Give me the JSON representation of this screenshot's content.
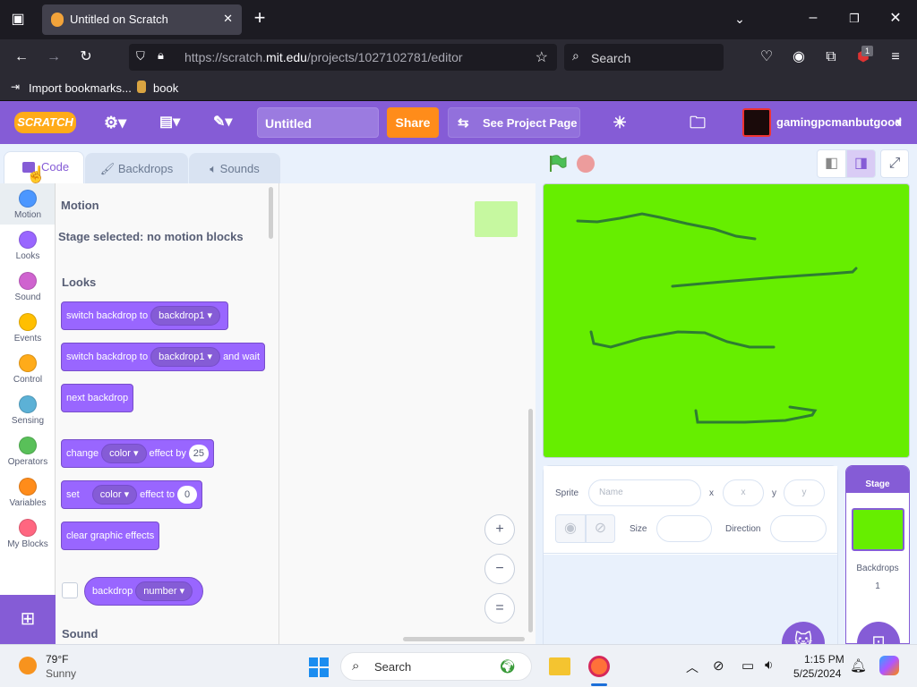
{
  "browser": {
    "tab_title": "Untitled on Scratch",
    "tab_close": "✕",
    "new_tab": "+",
    "url_prefix": "https://scratch.",
    "url_host": "mit.edu",
    "url_path": "/projects/1027102781/editor",
    "search_placeholder": "Search",
    "bookmarks": [
      {
        "label": "Import bookmarks..."
      },
      {
        "label": "book"
      }
    ],
    "extension_badge": "1"
  },
  "scratch_menu": {
    "logo": "SCRATCH",
    "project_title": "Untitled",
    "share_label": "Share",
    "see_project_label": "See Project Page",
    "username": "gamingpcmanbutgood"
  },
  "editor_tabs": [
    {
      "label": "Code"
    },
    {
      "label": "Backdrops"
    },
    {
      "label": "Sounds"
    }
  ],
  "categories": [
    {
      "label": "Motion",
      "color": "#4c97ff"
    },
    {
      "label": "Looks",
      "color": "#9966ff"
    },
    {
      "label": "Sound",
      "color": "#cf63cf"
    },
    {
      "label": "Events",
      "color": "#ffbf00"
    },
    {
      "label": "Control",
      "color": "#ffab19"
    },
    {
      "label": "Sensing",
      "color": "#5cb1d6"
    },
    {
      "label": "Operators",
      "color": "#59c059"
    },
    {
      "label": "Variables",
      "color": "#ff8c1a"
    },
    {
      "label": "My Blocks",
      "color": "#ff6680"
    }
  ],
  "palette": {
    "motion_title": "Motion",
    "motion_note": "Stage selected: no motion blocks",
    "looks_title": "Looks",
    "block1": {
      "text": "switch backdrop to",
      "dropdown": "backdrop1"
    },
    "block2": {
      "text": "switch backdrop to",
      "dropdown": "backdrop1",
      "suffix": "and wait"
    },
    "block3": {
      "text": "next backdrop"
    },
    "block4": {
      "text": "change",
      "dropdown": "color",
      "middle": "effect by",
      "value": "25"
    },
    "block5": {
      "text": "set",
      "dropdown": "color",
      "middle": "effect to",
      "value": "0"
    },
    "block6": {
      "text": "clear graphic effects"
    },
    "block7": {
      "text": "backdrop",
      "dropdown": "number"
    },
    "sound_title": "Sound"
  },
  "zoom": {
    "in": "+",
    "out": "−",
    "reset": "="
  },
  "sprite_info": {
    "sprite_label": "Sprite",
    "name_placeholder": "Name",
    "x_label": "x",
    "x_placeholder": "x",
    "y_label": "y",
    "y_placeholder": "y",
    "size_label": "Size",
    "direction_label": "Direction"
  },
  "stage_panel": {
    "title": "Stage",
    "backdrops_label": "Backdrops",
    "backdrops_count": "1"
  },
  "taskbar": {
    "temp": "79°F",
    "weather": "Sunny",
    "search": "Search",
    "time": "1:15 PM",
    "date": "5/25/2024"
  }
}
